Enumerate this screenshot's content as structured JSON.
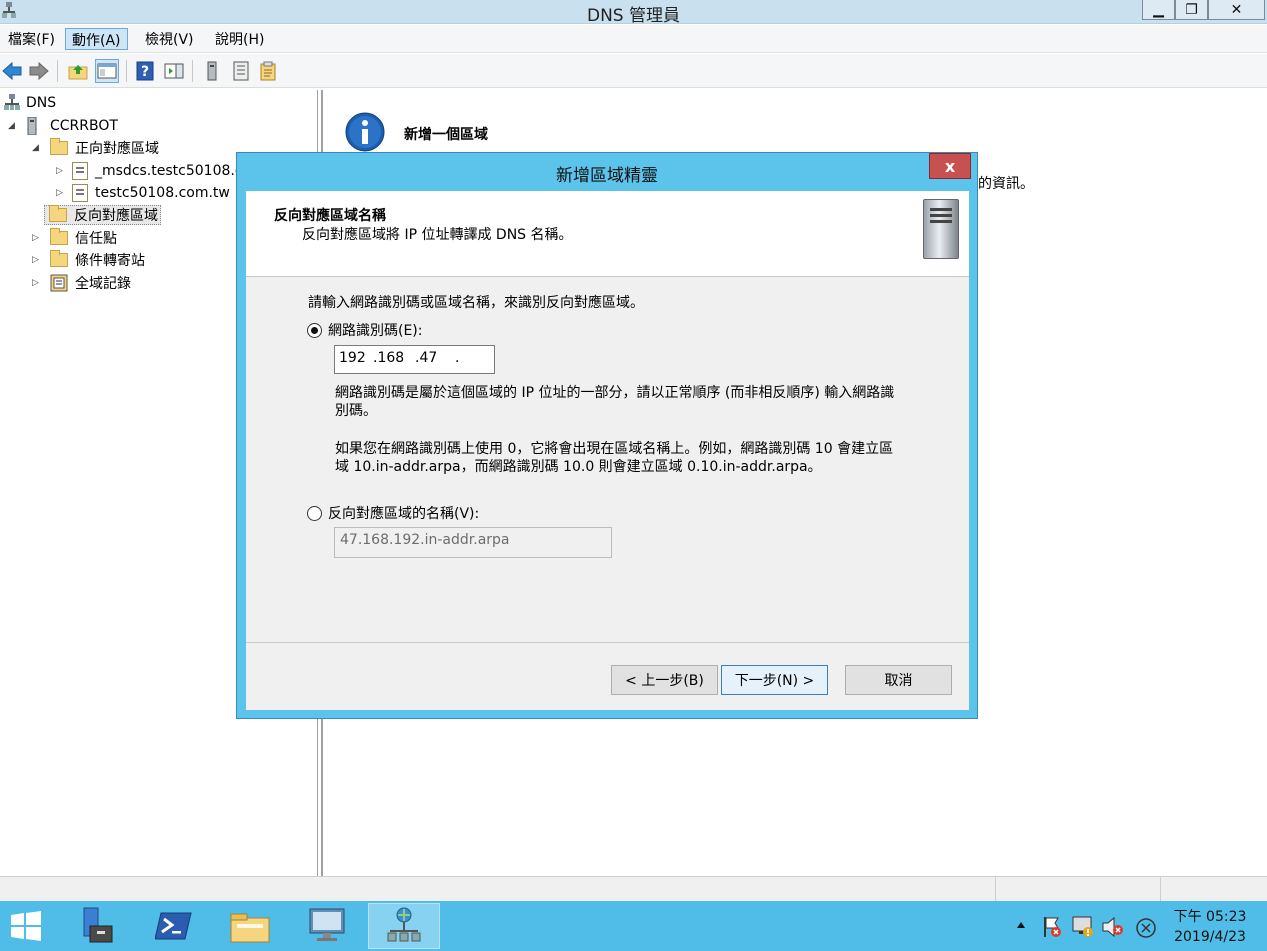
{
  "window": {
    "title": "DNS 管理員",
    "minimize_label": "▁",
    "restore_label": "❐",
    "close_label": "✕"
  },
  "menu": {
    "items": [
      "檔案(F)",
      "動作(A)",
      "檢視(V)",
      "說明(H)"
    ],
    "active": "動作(A)"
  },
  "toolbar": {
    "icons": [
      "back-icon",
      "forward-icon",
      "up-folder-icon",
      "show-hide-tree-icon",
      "help-icon",
      "action-pane-icon",
      "server-icon",
      "list-icon",
      "export-icon"
    ]
  },
  "tree": {
    "root": "DNS",
    "server": "CCRRBOT",
    "forward_zones": "正向對應區域",
    "forward_children": [
      "_msdcs.testc50108.c",
      "testc50108.com.tw"
    ],
    "reverse_zones": "反向對應區域",
    "trust_points": "信任點",
    "conditional_forwarders": "條件轉寄站",
    "global_logs": "全域記錄"
  },
  "right_panel": {
    "info_title": "新增一個區域",
    "info_text_fragment": "的資訊。"
  },
  "wizard": {
    "title": "新增區域精靈",
    "close_label": "x",
    "header_title": "反向對應區域名稱",
    "header_subtitle": "反向對應區域將 IP 位址轉譯成 DNS 名稱。",
    "instruction": "請輸入網路識別碼或區域名稱，來識別反向對應區域。",
    "option_network_id": "網路識別碼(E):",
    "ip_octets": [
      "192",
      ".168",
      ".47",
      "."
    ],
    "note1_line1": "網路識別碼是屬於這個區域的 IP 位址的一部分，請以正常順序 (而非相反順序) 輸入網路識",
    "note1_line2": "別碼。",
    "note2_line1": "如果您在網路識別碼上使用 0，它將會出現在區域名稱上。例如，網路識別碼 10 會建立區",
    "note2_line2": "域 10.in-addr.arpa，而網路識別碼 10.0 則會建立區域 0.10.in-addr.arpa。",
    "option_zone_name": "反向對應區域的名稱(V):",
    "zone_name_value": "47.168.192.in-addr.arpa",
    "back_button": "< 上一步(B)",
    "next_button": "下一步(N) >",
    "cancel_button": "取消"
  },
  "taskbar": {
    "time": "下午 05:23",
    "date": "2019/4/23"
  },
  "colors": {
    "taskbar": "#4fbde8",
    "wizard_frame": "#5cc3ea",
    "close_red": "#c75050",
    "info_blue": "#1d5fae"
  }
}
